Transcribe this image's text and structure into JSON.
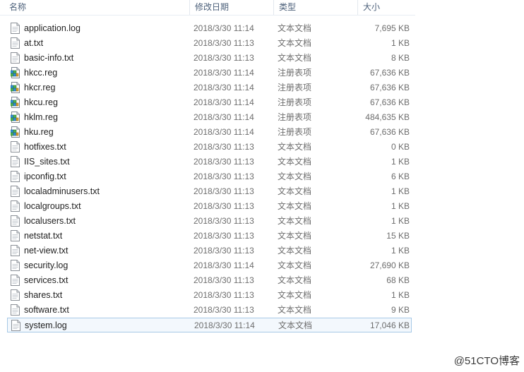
{
  "columns": {
    "name": "名称",
    "date": "修改日期",
    "type": "类型",
    "size": "大小"
  },
  "files": [
    {
      "name": "application.log",
      "date": "2018/3/30 11:14",
      "type": "文本文档",
      "size": "7,695 KB",
      "icon": "text-file-icon"
    },
    {
      "name": "at.txt",
      "date": "2018/3/30 11:13",
      "type": "文本文档",
      "size": "1 KB",
      "icon": "text-file-icon"
    },
    {
      "name": "basic-info.txt",
      "date": "2018/3/30 11:13",
      "type": "文本文档",
      "size": "8 KB",
      "icon": "text-file-icon"
    },
    {
      "name": "hkcc.reg",
      "date": "2018/3/30 11:14",
      "type": "注册表项",
      "size": "67,636 KB",
      "icon": "registry-file-icon"
    },
    {
      "name": "hkcr.reg",
      "date": "2018/3/30 11:14",
      "type": "注册表项",
      "size": "67,636 KB",
      "icon": "registry-file-icon"
    },
    {
      "name": "hkcu.reg",
      "date": "2018/3/30 11:14",
      "type": "注册表项",
      "size": "67,636 KB",
      "icon": "registry-file-icon"
    },
    {
      "name": "hklm.reg",
      "date": "2018/3/30 11:14",
      "type": "注册表项",
      "size": "484,635 KB",
      "icon": "registry-file-icon"
    },
    {
      "name": "hku.reg",
      "date": "2018/3/30 11:14",
      "type": "注册表项",
      "size": "67,636 KB",
      "icon": "registry-file-icon"
    },
    {
      "name": "hotfixes.txt",
      "date": "2018/3/30 11:13",
      "type": "文本文档",
      "size": "0 KB",
      "icon": "text-file-icon"
    },
    {
      "name": "IIS_sites.txt",
      "date": "2018/3/30 11:13",
      "type": "文本文档",
      "size": "1 KB",
      "icon": "text-file-icon"
    },
    {
      "name": "ipconfig.txt",
      "date": "2018/3/30 11:13",
      "type": "文本文档",
      "size": "6 KB",
      "icon": "text-file-icon"
    },
    {
      "name": "localadminusers.txt",
      "date": "2018/3/30 11:13",
      "type": "文本文档",
      "size": "1 KB",
      "icon": "text-file-icon"
    },
    {
      "name": "localgroups.txt",
      "date": "2018/3/30 11:13",
      "type": "文本文档",
      "size": "1 KB",
      "icon": "text-file-icon"
    },
    {
      "name": "localusers.txt",
      "date": "2018/3/30 11:13",
      "type": "文本文档",
      "size": "1 KB",
      "icon": "text-file-icon"
    },
    {
      "name": "netstat.txt",
      "date": "2018/3/30 11:13",
      "type": "文本文档",
      "size": "15 KB",
      "icon": "text-file-icon"
    },
    {
      "name": "net-view.txt",
      "date": "2018/3/30 11:13",
      "type": "文本文档",
      "size": "1 KB",
      "icon": "text-file-icon"
    },
    {
      "name": "security.log",
      "date": "2018/3/30 11:14",
      "type": "文本文档",
      "size": "27,690 KB",
      "icon": "text-file-icon"
    },
    {
      "name": "services.txt",
      "date": "2018/3/30 11:13",
      "type": "文本文档",
      "size": "68 KB",
      "icon": "text-file-icon"
    },
    {
      "name": "shares.txt",
      "date": "2018/3/30 11:13",
      "type": "文本文档",
      "size": "1 KB",
      "icon": "text-file-icon"
    },
    {
      "name": "software.txt",
      "date": "2018/3/30 11:13",
      "type": "文本文档",
      "size": "9 KB",
      "icon": "text-file-icon"
    },
    {
      "name": "system.log",
      "date": "2018/3/30 11:14",
      "type": "文本文档",
      "size": "17,046 KB",
      "icon": "text-file-icon",
      "selected": true
    }
  ],
  "watermark": "@51CTO博客",
  "colors": {
    "header_text": "#4c607a",
    "selection_border": "#a6c8e6",
    "selection_fill": "#f3f8fd",
    "secondary_text": "#6d6d6d"
  }
}
